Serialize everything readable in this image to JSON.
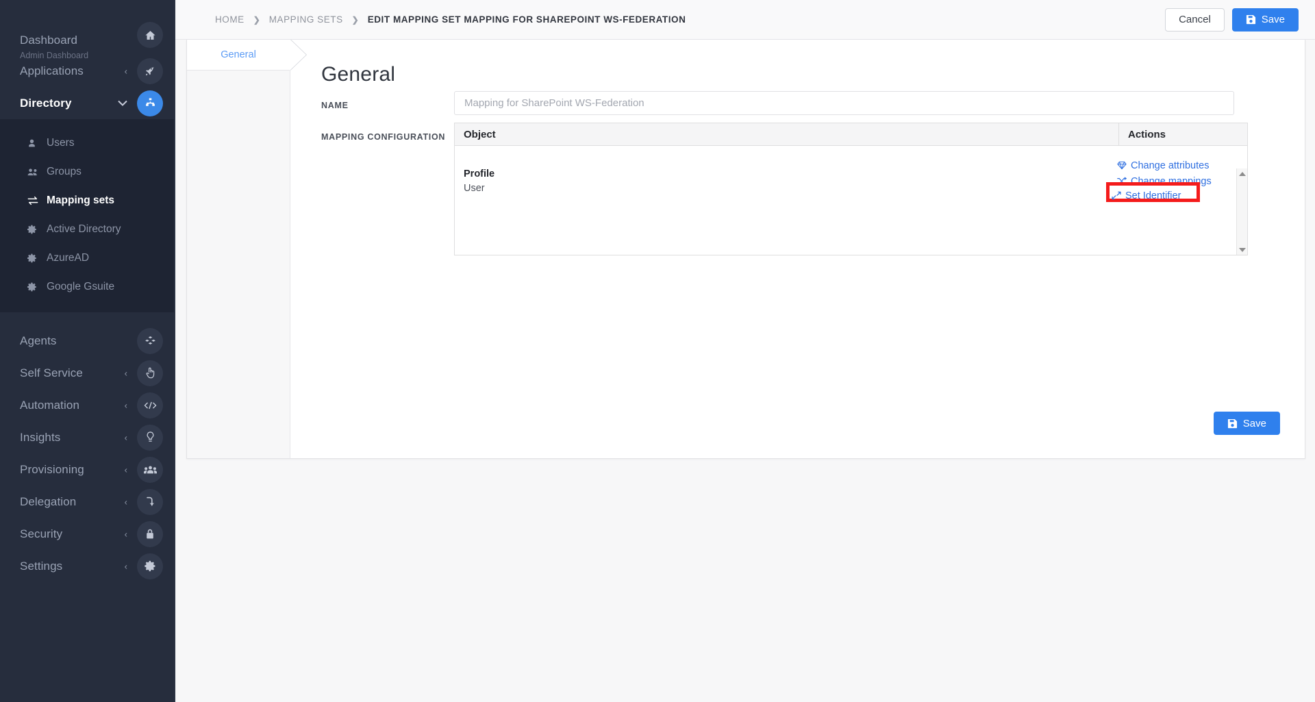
{
  "sidebar": {
    "top_items": [
      {
        "label": "Dashboard",
        "sub_label": "Admin Dashboard",
        "icon": "home-icon",
        "chevron": "",
        "active": false,
        "accent": false
      },
      {
        "label": "Applications",
        "sub_label": "",
        "icon": "rocket-icon",
        "chevron": "‹",
        "active": false,
        "accent": false
      },
      {
        "label": "Directory",
        "sub_label": "",
        "icon": "sitemap-icon",
        "chevron": "⌄",
        "active": true,
        "accent": true
      }
    ],
    "sub_items": [
      {
        "label": "Users",
        "icon": "user-icon",
        "active": false
      },
      {
        "label": "Groups",
        "icon": "users-icon",
        "active": false
      },
      {
        "label": "Mapping sets",
        "icon": "exchange-icon",
        "active": true
      },
      {
        "label": "Active Directory",
        "icon": "gear-icon",
        "active": false
      },
      {
        "label": "AzureAD",
        "icon": "gear-icon",
        "active": false
      },
      {
        "label": "Google Gsuite",
        "icon": "gear-icon",
        "active": false
      }
    ],
    "bottom_items": [
      {
        "label": "Agents",
        "icon": "cubes-icon",
        "chevron": ""
      },
      {
        "label": "Self Service",
        "icon": "hand-pointer-icon",
        "chevron": "‹"
      },
      {
        "label": "Automation",
        "icon": "code-icon",
        "chevron": "‹"
      },
      {
        "label": "Insights",
        "icon": "lightbulb-icon",
        "chevron": "‹"
      },
      {
        "label": "Provisioning",
        "icon": "user-group-icon",
        "chevron": "‹"
      },
      {
        "label": "Delegation",
        "icon": "arrow-turn-down-icon",
        "chevron": "‹"
      },
      {
        "label": "Security",
        "icon": "lock-icon",
        "chevron": "‹"
      },
      {
        "label": "Settings",
        "icon": "gear-icon",
        "chevron": "‹"
      }
    ]
  },
  "topbar": {
    "breadcrumb": [
      {
        "label": "HOME"
      },
      {
        "label": "MAPPING SETS"
      },
      {
        "label": "EDIT MAPPING SET MAPPING FOR SHAREPOINT WS-FEDERATION"
      }
    ],
    "separator": "❯",
    "cancel_label": "Cancel",
    "save_label": "Save"
  },
  "card": {
    "tabs": [
      {
        "label": "General",
        "active": true
      }
    ],
    "pane_title": "General",
    "fields": {
      "name_label": "NAME",
      "name_value": "Mapping for SharePoint WS-Federation",
      "name_placeholder": "Mapping for SharePoint WS-Federation",
      "mapping_config_label": "MAPPING CONFIGURATION"
    },
    "table": {
      "columns": [
        "Object",
        "Actions"
      ],
      "rows": [
        {
          "object_title": "Profile",
          "object_sub": "User",
          "actions": [
            {
              "label": "Change attributes",
              "icon": "gem-icon"
            },
            {
              "label": "Change mappings",
              "icon": "shuffle-icon"
            },
            {
              "label": "Set Identifier",
              "icon": "compress-arrows-icon",
              "highlighted": true
            }
          ]
        }
      ]
    },
    "save_label": "Save"
  },
  "colors": {
    "sidebar_bg": "#262d3d",
    "sidebar_sub_bg": "#1e2433",
    "accent": "#3b89e8",
    "primary_button": "#2f80ed",
    "link": "#2f6fe0",
    "highlight_border": "#f41b1b"
  }
}
